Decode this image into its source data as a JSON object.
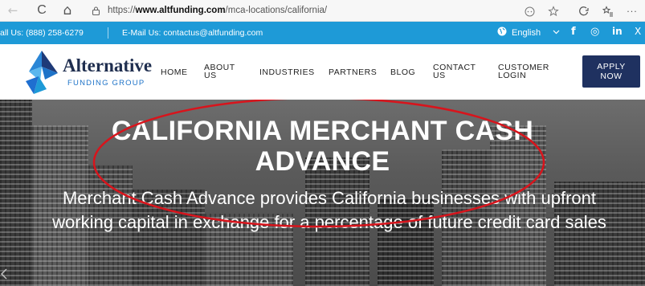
{
  "browser": {
    "url_prefix": "https://",
    "url_host": "www.altfunding.com",
    "url_path": "/mca-locations/california/",
    "back": "←",
    "refresh": "C",
    "home": "⌂",
    "more": "···"
  },
  "info_bar": {
    "call": "all Us: (888) 258-6279",
    "email": "E-Mail Us: contactus@altfunding.com",
    "language": "English",
    "social": [
      "f",
      "◎",
      "in",
      "X"
    ]
  },
  "logo": {
    "name": "Alternative",
    "sub": "FUNDING GROUP"
  },
  "nav": {
    "home": "HOME",
    "about": [
      "ABOUT",
      "US"
    ],
    "industries": "INDUSTRIES",
    "partners": "PARTNERS",
    "blog": "BLOG",
    "contact": [
      "CONTACT",
      "US"
    ],
    "customer_login": [
      "CUSTOMER",
      "LOGIN"
    ],
    "apply": [
      "APPLY",
      "NOW"
    ]
  },
  "hero": {
    "title_line1": "CALIFORNIA MERCHANT CASH",
    "title_line2": "ADVANCE",
    "subtitle": "Merchant Cash Advance provides California businesses with upfront working capital in exchange for a percentage of future credit card sales"
  },
  "colors": {
    "info_bar": "#1e9ad7",
    "brand_navy": "#1f3160",
    "annotation": "#d8141c"
  }
}
